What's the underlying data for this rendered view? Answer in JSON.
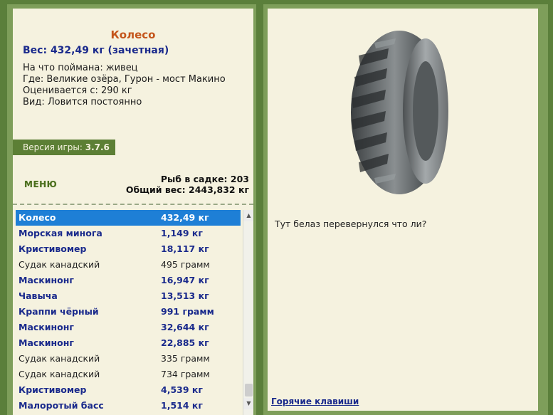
{
  "fish": {
    "title": "Колесо",
    "weight": "Вес: 432,49 кг (зачетная)",
    "caught_on": "На что поймана: живец",
    "location": "Где: Великие озёра, Гурон - мост Макино",
    "valued_from": "Оценивается с: 290 кг",
    "kind": "Вид: Ловится постоянно"
  },
  "version": {
    "label": "Версия игры:",
    "value": "3.7.6"
  },
  "menu_label": "МЕНЮ",
  "stats": {
    "count": "Рыб в садке: 203",
    "total": "Общий вес: 2443,832 кг"
  },
  "catch_list": [
    {
      "name": "Колесо",
      "weight": "432,49 кг",
      "style": "selected"
    },
    {
      "name": "Морская минога",
      "weight": "1,149 кг",
      "style": "bold"
    },
    {
      "name": "Кристивомер",
      "weight": "18,117 кг",
      "style": "bold"
    },
    {
      "name": "Судак канадский",
      "weight": "495 грамм",
      "style": "plain"
    },
    {
      "name": "Маскинонг",
      "weight": "16,947 кг",
      "style": "bold"
    },
    {
      "name": "Чавыча",
      "weight": "13,513 кг",
      "style": "bold"
    },
    {
      "name": "Краппи чёрный",
      "weight": "991 грамм",
      "style": "bold"
    },
    {
      "name": "Маскинонг",
      "weight": "32,644 кг",
      "style": "bold"
    },
    {
      "name": "Маскинонг",
      "weight": "22,885 кг",
      "style": "bold"
    },
    {
      "name": "Судак канадский",
      "weight": "335 грамм",
      "style": "plain"
    },
    {
      "name": "Судак канадский",
      "weight": "734 грамм",
      "style": "plain"
    },
    {
      "name": "Кристивомер",
      "weight": "4,539 кг",
      "style": "bold"
    },
    {
      "name": "Малоротый басс",
      "weight": "1,514 кг",
      "style": "bold"
    }
  ],
  "comment": "Тут белаз перевернулся что ли?",
  "hotkeys_label": "Горячие клавиши",
  "colors": {
    "frame_green": "#5b7f3b",
    "panel_bg": "#f5f2df",
    "title_orange": "#c4551b",
    "bold_blue": "#1a2a8c",
    "selected_blue": "#1e7fd6"
  },
  "icons": {
    "scroll_up": "triangle-up-icon",
    "scroll_down": "triangle-down-icon",
    "picture": "tire-image"
  }
}
